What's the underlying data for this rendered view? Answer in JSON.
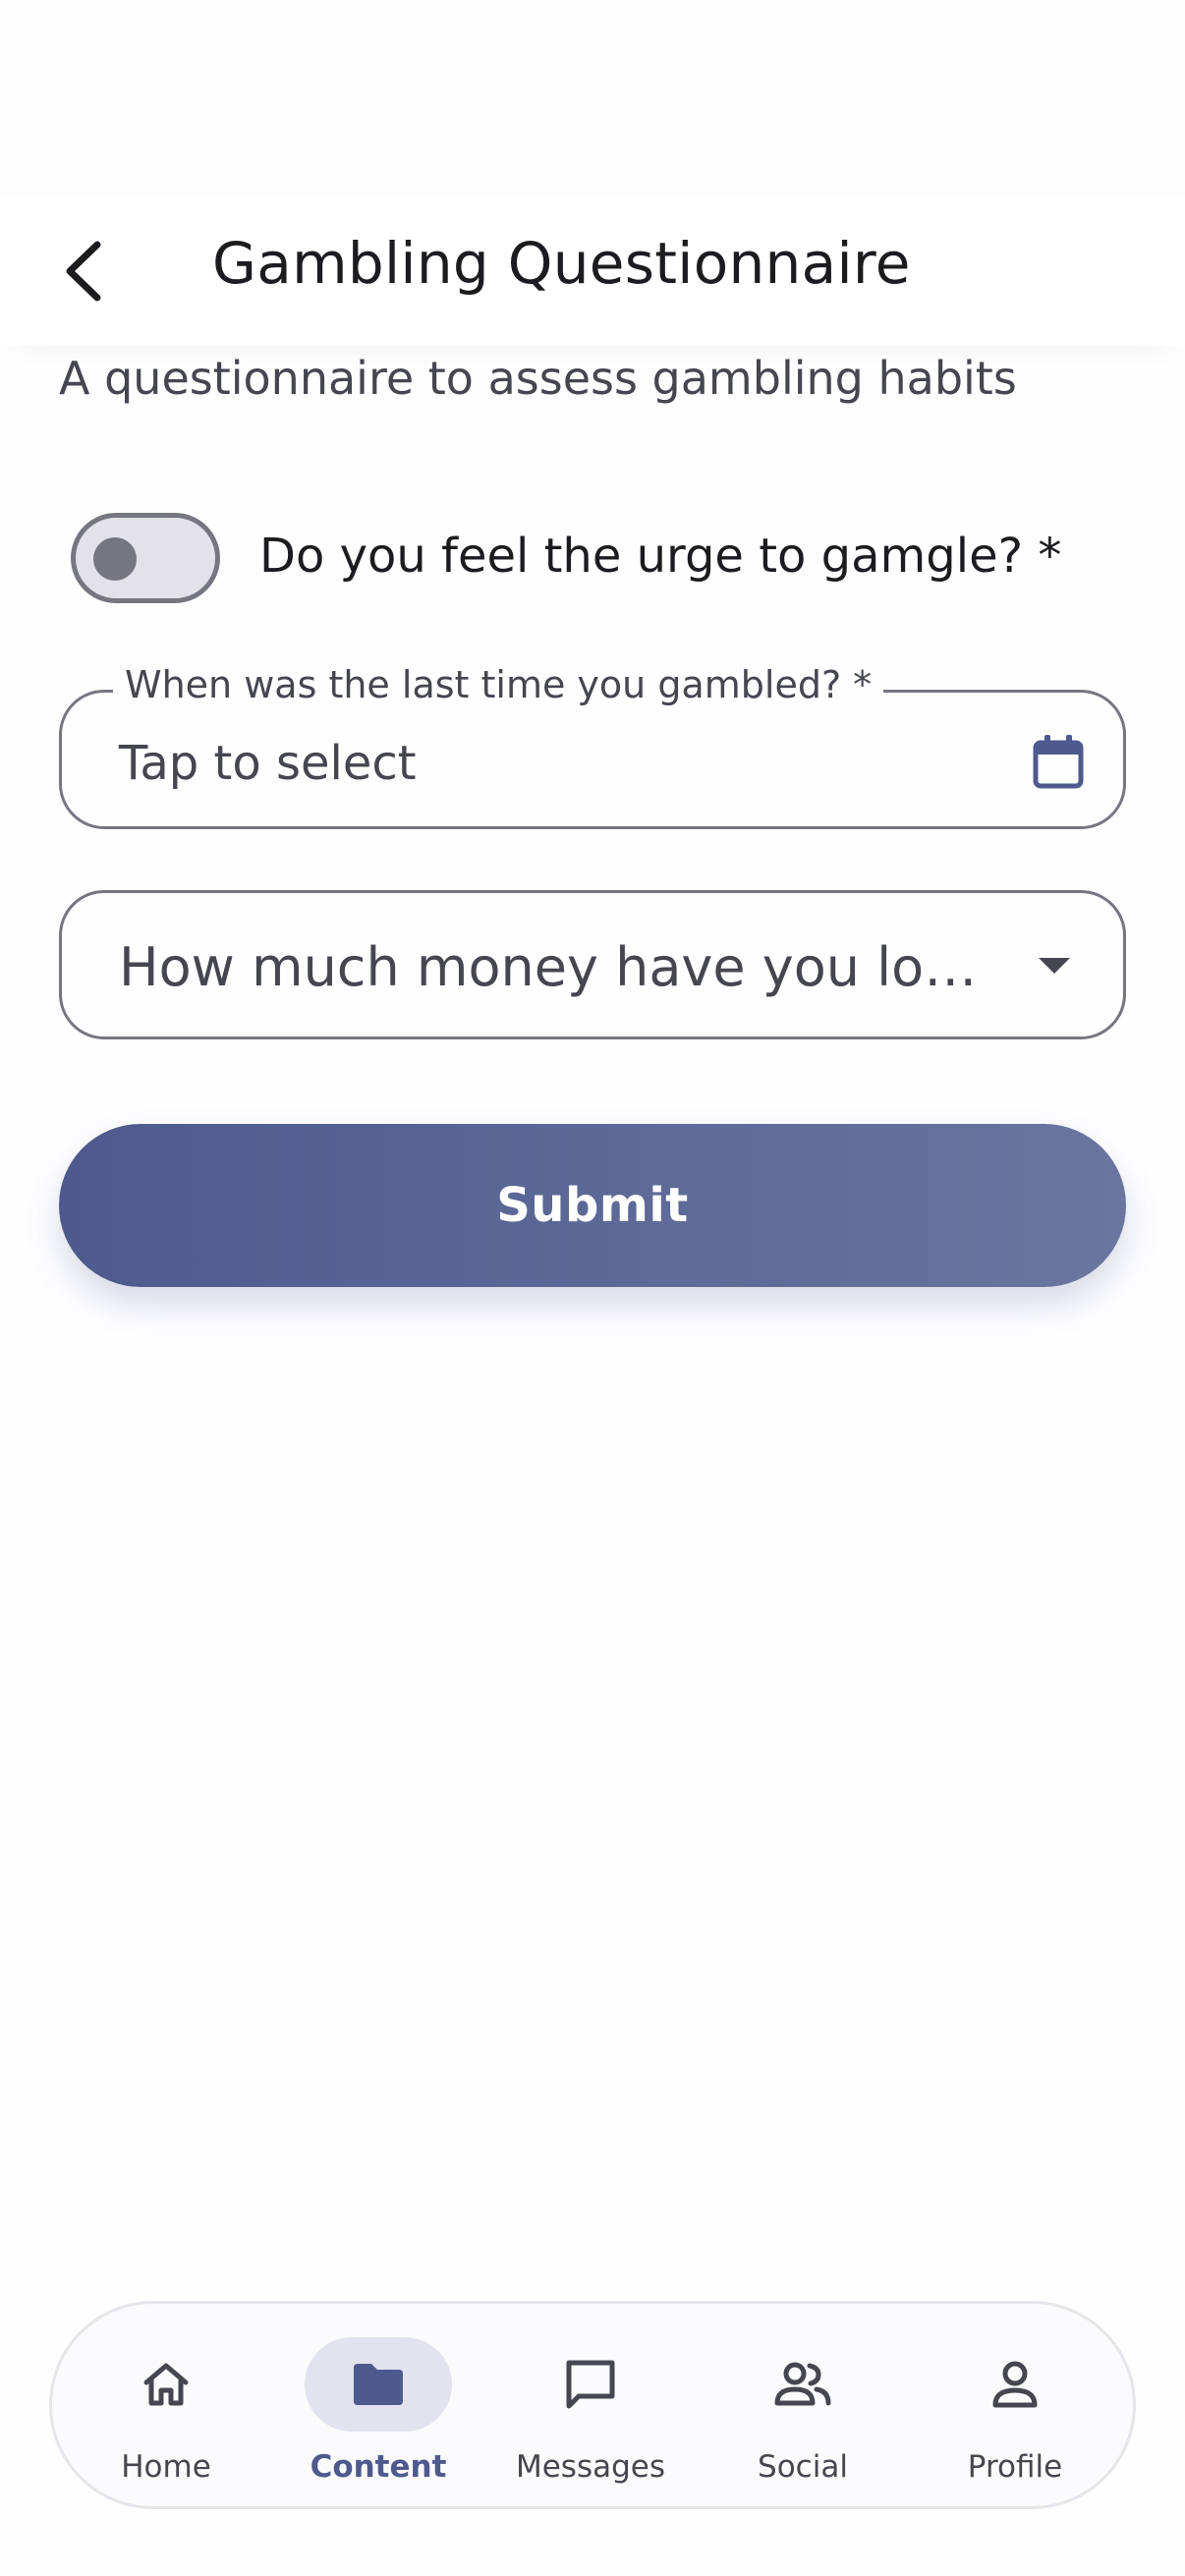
{
  "header": {
    "title": "Gambling Questionnaire",
    "subtitle": "A questionnaire to assess gambling habits"
  },
  "form": {
    "toggle": {
      "label": "Do you feel the urge to gamgle? *",
      "checked": false
    },
    "date_field": {
      "label": "When was the last time you gambled? *",
      "value": "Tap to select"
    },
    "dropdown": {
      "selected": "How much money have you lost t..."
    },
    "submit_label": "Submit"
  },
  "bottom_nav": {
    "items": [
      {
        "label": "Home",
        "icon": "home-icon",
        "active": false
      },
      {
        "label": "Content",
        "icon": "folder-icon",
        "active": true
      },
      {
        "label": "Messages",
        "icon": "message-icon",
        "active": false
      },
      {
        "label": "Social",
        "icon": "people-icon",
        "active": false
      },
      {
        "label": "Profile",
        "icon": "person-icon",
        "active": false
      }
    ]
  },
  "colors": {
    "primary": "#4e5a8d",
    "primary_light": "#6a769f",
    "outline": "#767680",
    "active_indicator": "#e2e3ee",
    "text_primary": "#1c1b1f",
    "text_secondary": "#45464f"
  }
}
